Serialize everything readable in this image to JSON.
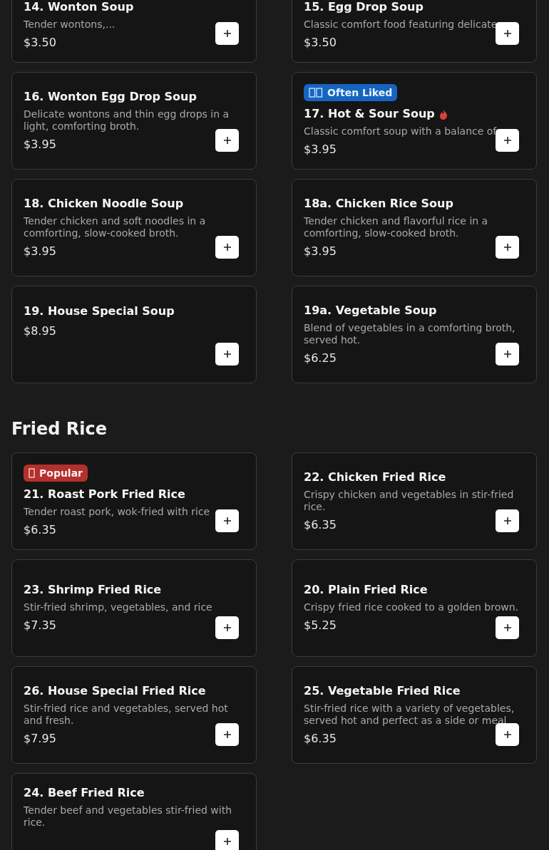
{
  "sections": [
    {
      "items": [
        {
          "name": "14. Wonton Soup",
          "description": "Tender wontons,...",
          "price": "$3.50",
          "spicy": false
        },
        {
          "name": "15. Egg Drop Soup",
          "description": "Classic comfort food featuring delicate",
          "price": "$3.50",
          "spicy": false
        },
        {
          "name": "16. Wonton Egg Drop Soup",
          "description": "Delicate wontons and thin egg drops in a light, comforting broth.",
          "price": "$3.95",
          "spicy": false
        },
        {
          "name": "17. Hot & Sour Soup",
          "description": "Classic comfort soup with a balance of",
          "price": "$3.95",
          "badge": {
            "kind": "liked",
            "label": "Often Liked",
            "color": "#1565c0"
          },
          "spicy": true
        },
        {
          "name": "18. Chicken Noodle Soup",
          "description": "Tender chicken and soft noodles in a comforting, slow-cooked broth.",
          "price": "$3.95",
          "spicy": false
        },
        {
          "name": "18a. Chicken Rice Soup",
          "description": "Tender chicken and flavorful rice in a comforting, slow-cooked broth.",
          "price": "$3.95",
          "spicy": false
        },
        {
          "name": "19. House Special Soup",
          "price": "$8.95",
          "spicy": false
        },
        {
          "name": "19a. Vegetable Soup",
          "description": "Blend of vegetables in a comforting broth, served hot.",
          "price": "$6.25",
          "spicy": false
        }
      ]
    },
    {
      "title": "Fried Rice",
      "items": [
        {
          "name": "21. Roast Pork Fried Rice",
          "description": "Tender roast pork, wok-fried with rice",
          "price": "$6.35",
          "badge": {
            "kind": "popular",
            "label": "Popular",
            "color": "#b3302c"
          },
          "spicy": false
        },
        {
          "name": "22. Chicken Fried Rice",
          "description": "Crispy chicken and vegetables in stir-fried rice.",
          "price": "$6.35",
          "spicy": false
        },
        {
          "name": "23. Shrimp Fried Rice",
          "description": "Stir-fried shrimp, vegetables, and rice",
          "price": "$7.35",
          "spicy": false
        },
        {
          "name": "20. Plain Fried Rice",
          "description": "Crispy fried rice cooked to a golden brown.",
          "price": "$5.25",
          "spicy": false
        },
        {
          "name": "26. House Special Fried Rice",
          "description": "Stir-fried rice and vegetables, served hot and fresh.",
          "price": "$7.95",
          "spicy": false
        },
        {
          "name": "25. Vegetable Fried Rice",
          "description": "Stir-fried rice with a variety of vegetables, served hot and perfect as a side or meal",
          "price": "$6.35",
          "spicy": false
        },
        {
          "name": "24. Beef Fried Rice",
          "description": "Tender beef and vegetables stir-fried with rice.",
          "spicy": false
        }
      ]
    }
  ]
}
